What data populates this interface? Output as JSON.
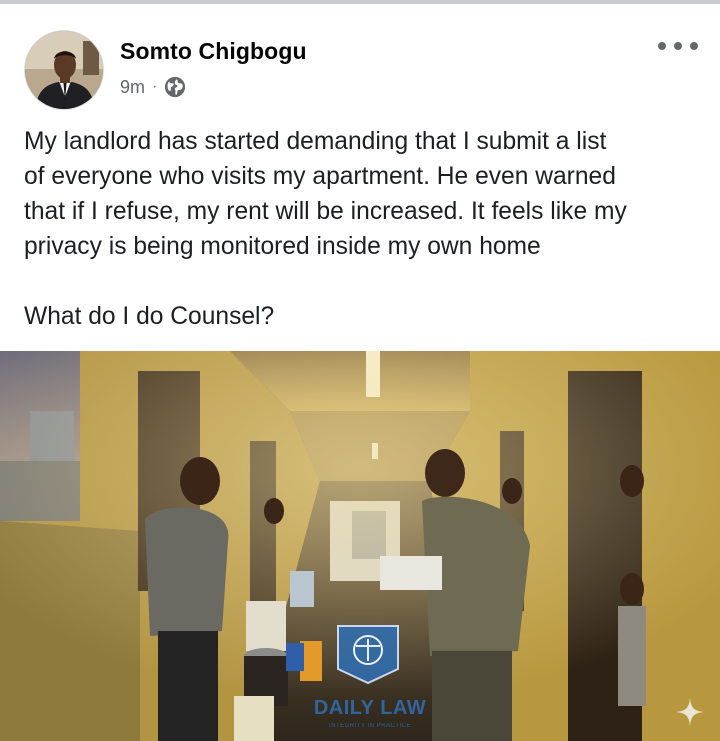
{
  "post": {
    "author": "Somto Chigbogu",
    "time": "9m",
    "separator": "·",
    "audience_icon": "globe-icon",
    "more_icon": "more-options-icon",
    "body_lines": [
      "My landlord has started demanding that I submit a list",
      "of everyone who visits my apartment. He even warned",
      "that if I refuse, my rent will be increased. It feels like my",
      "privacy is being monitored inside my own home"
    ],
    "question": "What do I do Counsel?"
  },
  "image": {
    "watermark": "DAILY LAW",
    "watermark_sub": "INTEGRITY IN PRACTICE",
    "corner_icon": "sparkle-icon"
  },
  "colors": {
    "text_primary": "#050505",
    "text_secondary": "#65676b",
    "wall_yellow": "#b89a4e",
    "watermark_blue": "#2f6fb5"
  }
}
